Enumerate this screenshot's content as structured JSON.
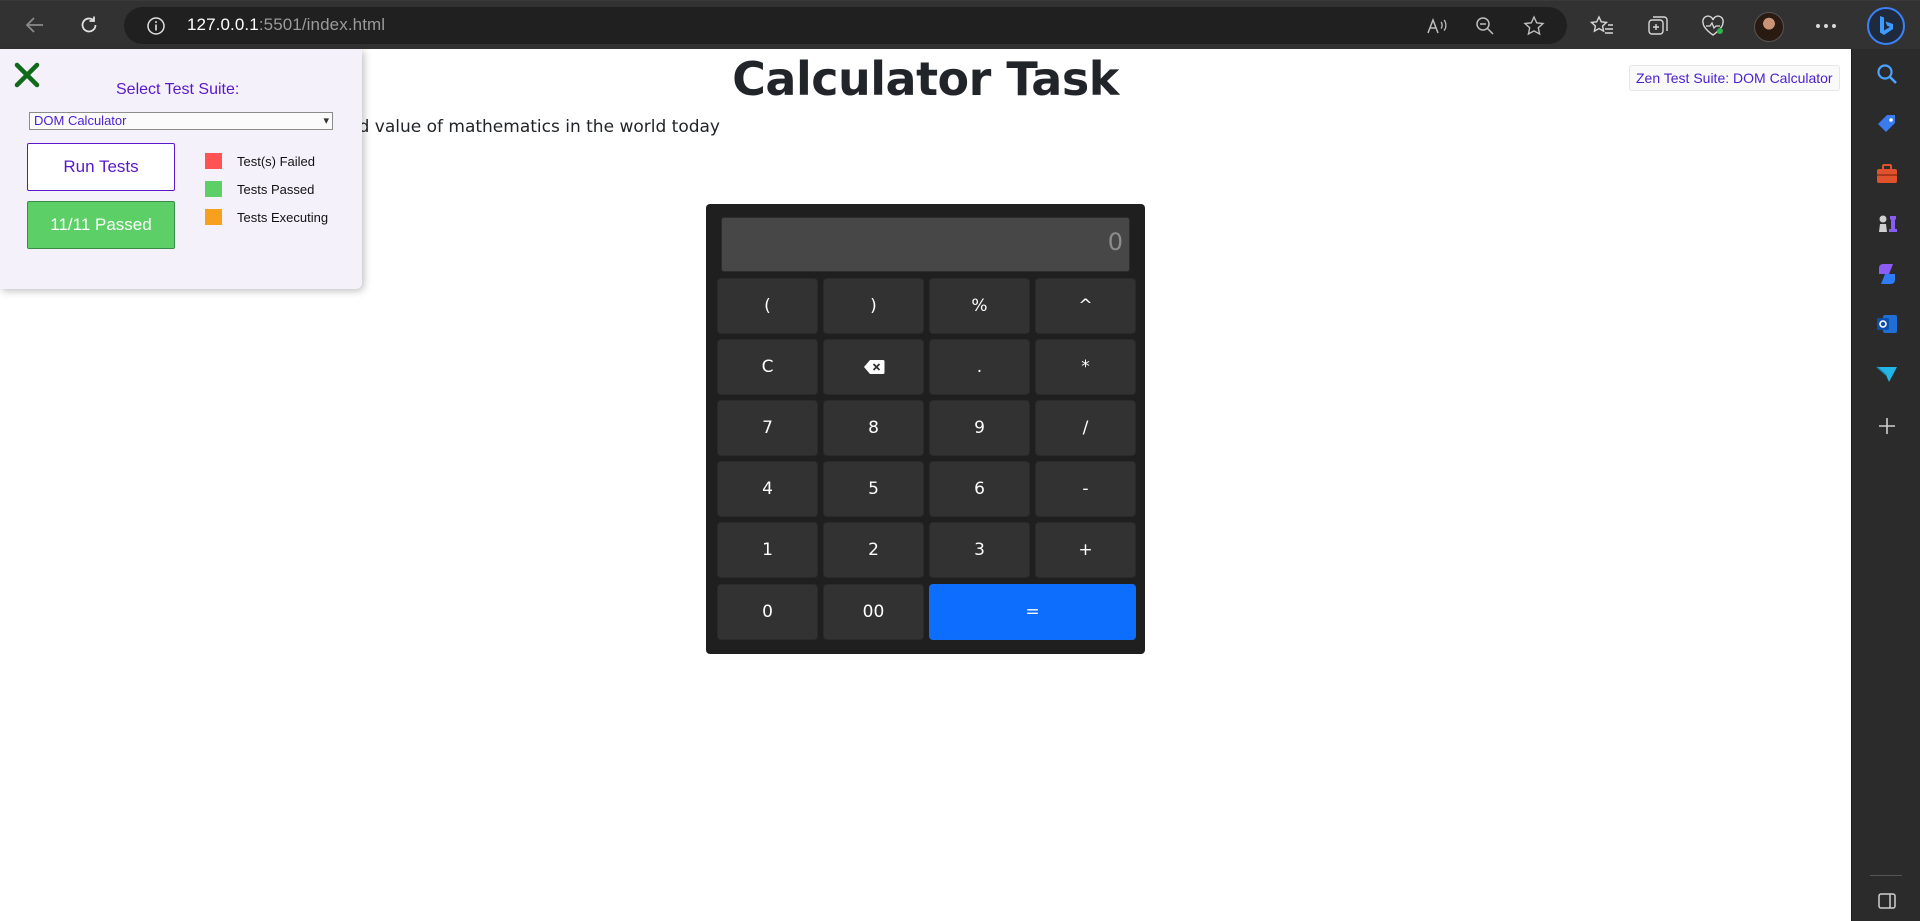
{
  "browser": {
    "url_host": "127.0.0.1",
    "url_path": ":5501/index.html"
  },
  "page": {
    "title": "Calculator Task",
    "subtitle": "and value of mathematics in the world today",
    "zen_tag": "Zen Test Suite: DOM Calculator"
  },
  "calculator": {
    "display_value": "0",
    "keys": [
      [
        "(",
        ")",
        "%",
        "^"
      ],
      [
        "C",
        "backspace",
        ".",
        "*"
      ],
      [
        "7",
        "8",
        "9",
        "/"
      ],
      [
        "4",
        "5",
        "6",
        "-"
      ],
      [
        "1",
        "2",
        "3",
        "+"
      ],
      [
        "0",
        "00",
        "="
      ]
    ],
    "equals_color": "#0d6efd"
  },
  "test_panel": {
    "select_label": "Select Test Suite:",
    "selected_suite": "DOM Calculator",
    "run_button": "Run Tests",
    "result_button": "11/11 Passed",
    "legend": [
      {
        "label": "Test(s) Failed",
        "color": "#ff5252"
      },
      {
        "label": "Tests Passed",
        "color": "#5cd066"
      },
      {
        "label": "Tests Executing",
        "color": "#f7a01e"
      }
    ]
  }
}
